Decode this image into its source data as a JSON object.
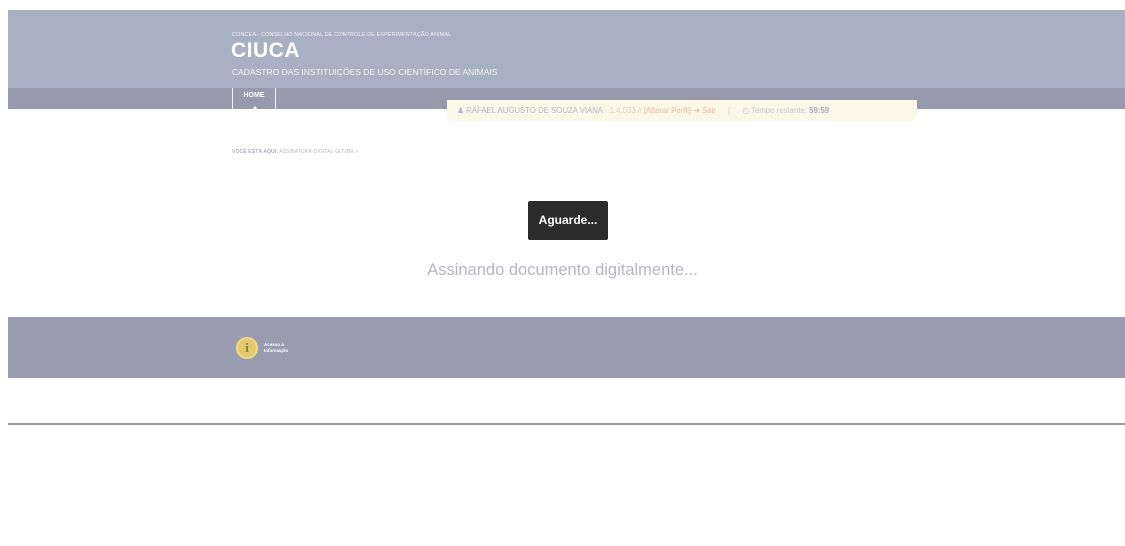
{
  "header": {
    "org_line": "CONCEA - CONSELHO NACIONAL DE CONTROLE DE EXPERIMENTAÇÃO ANIMAL",
    "app_title": "CIUCA",
    "app_subtitle": "CADASTRO DAS INSTITUIÇÕES DE USO CIENTÍFICO DE ANIMAIS"
  },
  "nav": {
    "home_label": "HOME"
  },
  "userbar": {
    "user_name": "RAFAEL AUGUSTO DE SOUZA VIANA",
    "institution": " - 1.4.033 /i",
    "change_profile_label": "[Alterar Perfil]",
    "logout_label": "Sair",
    "separator": "|",
    "time_label": "Tempo restante:",
    "time_value": "59:59"
  },
  "breadcrumb": {
    "label": "VOCÊ ESTÁ AQUI:",
    "current": "ASSINATURA-DIGITAL-GOVBR »"
  },
  "loading": {
    "wait_label": "Aguarde...",
    "message": "Assinando documento digitalmente..."
  },
  "footer": {
    "acesso_line1": "Acesso à",
    "acesso_line2": "Informação"
  },
  "icons": {
    "user": "user-icon",
    "logout": "logout-icon",
    "clock": "clock-icon",
    "info": "info-icon"
  }
}
